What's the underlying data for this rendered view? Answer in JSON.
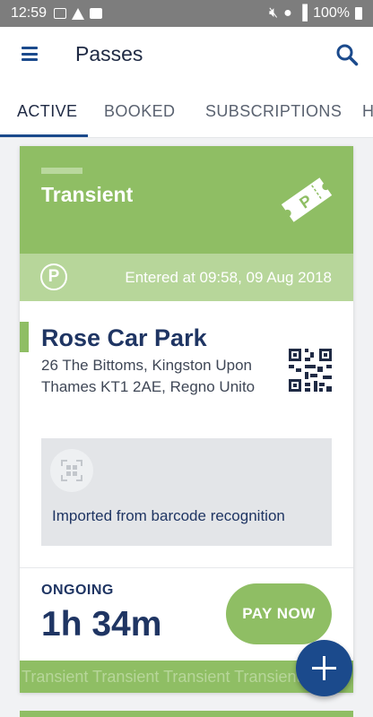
{
  "status_bar": {
    "time": "12:59",
    "battery": "100%"
  },
  "app_bar": {
    "title": "Passes",
    "menu_icon": "hamburger-menu-icon",
    "search_icon": "search-icon"
  },
  "tabs": [
    {
      "label": "ACTIVE",
      "active": true
    },
    {
      "label": "BOOKED",
      "active": false
    },
    {
      "label": "SUBSCRIPTIONS",
      "active": false
    },
    {
      "label": "H",
      "active": false
    }
  ],
  "pass": {
    "type": "Transient",
    "entered": "Entered at 09:58, 09 Aug 2018",
    "location_name": "Rose Car Park",
    "address": "26 The Bittoms, Kingston Upon Thames KT1 2AE, Regno Unito",
    "import_note": "Imported from barcode recognition",
    "status": "ONGOING",
    "duration": "1h 34m",
    "pay_button": "PAY NOW",
    "marquee": "Transient Transient Transient Transient"
  },
  "colors": {
    "accent_green": "#8fbe64",
    "light_green": "#b7d69a",
    "brand_blue": "#1b4a8c",
    "navy_text": "#1f3563"
  }
}
